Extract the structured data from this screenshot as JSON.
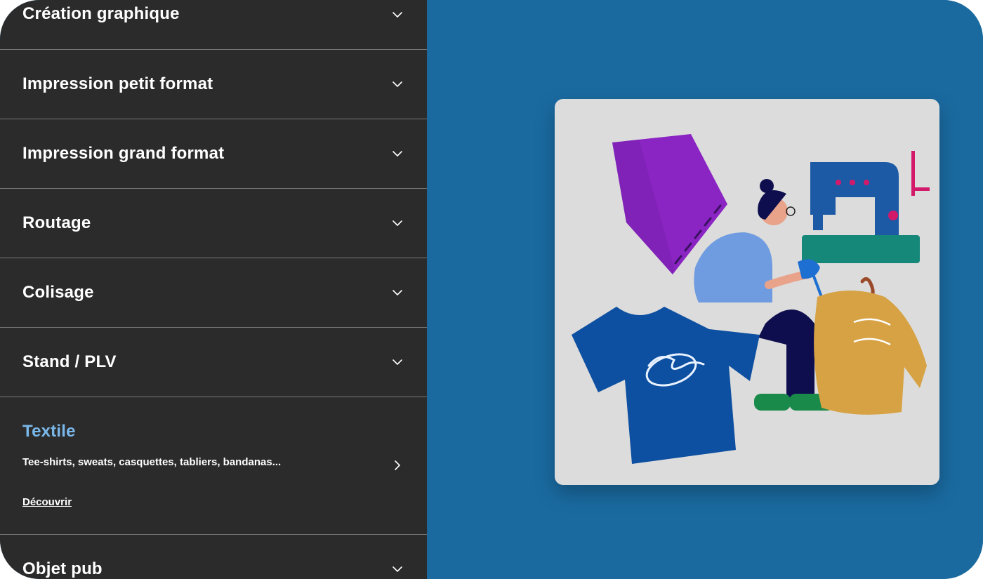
{
  "menu": {
    "items": [
      {
        "label": "Création graphique"
      },
      {
        "label": "Impression petit format"
      },
      {
        "label": "Impression grand format"
      },
      {
        "label": "Routage"
      },
      {
        "label": "Colisage"
      },
      {
        "label": "Stand / PLV"
      },
      {
        "label": "Textile",
        "description": "Tee-shirts, sweats, casquettes, tabliers, bandanas...",
        "link": "Découvrir",
        "active": true
      },
      {
        "label": "Objet pub"
      }
    ]
  },
  "illustration": {
    "subject": "textile-illustration"
  },
  "colors": {
    "menu_background": "#2b2b2b",
    "panel_background": "#1a6aa0",
    "active_label": "#7ab8ea",
    "card_background": "#dcdcdc"
  }
}
